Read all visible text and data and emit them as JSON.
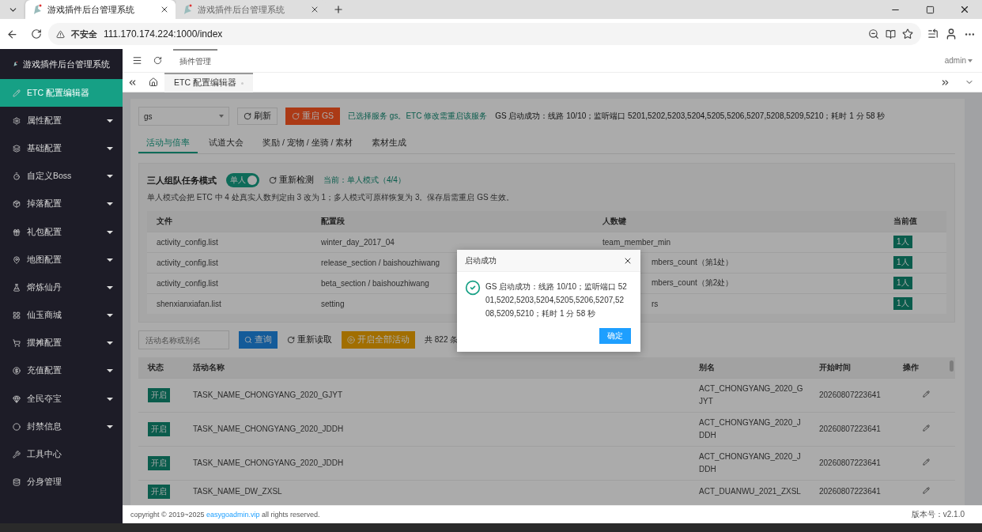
{
  "browser": {
    "tabs": [
      {
        "title": "游戏插件后台管理系统",
        "selected": true
      },
      {
        "title": "游戏插件后台管理系统",
        "selected": false
      }
    ],
    "security": "不安全",
    "url": "111.170.174.224:1000/index"
  },
  "sidebar": {
    "title": "游戏插件后台管理系统",
    "items": [
      {
        "label": "ETC 配置编辑器",
        "selected": true,
        "expandable": false
      },
      {
        "label": "属性配置",
        "selected": false,
        "expandable": true
      },
      {
        "label": "基础配置",
        "selected": false,
        "expandable": true
      },
      {
        "label": "自定义Boss",
        "selected": false,
        "expandable": true
      },
      {
        "label": "掉落配置",
        "selected": false,
        "expandable": true
      },
      {
        "label": "礼包配置",
        "selected": false,
        "expandable": true
      },
      {
        "label": "地图配置",
        "selected": false,
        "expandable": true
      },
      {
        "label": "熔炼仙丹",
        "selected": false,
        "expandable": true
      },
      {
        "label": "仙玉商城",
        "selected": false,
        "expandable": true
      },
      {
        "label": "摆摊配置",
        "selected": false,
        "expandable": true
      },
      {
        "label": "充值配置",
        "selected": false,
        "expandable": true
      },
      {
        "label": "全民夺宝",
        "selected": false,
        "expandable": true
      },
      {
        "label": "封禁信息",
        "selected": false,
        "expandable": true
      },
      {
        "label": "工具中心",
        "selected": false,
        "expandable": false
      },
      {
        "label": "分身管理",
        "selected": false,
        "expandable": false
      }
    ]
  },
  "header": {
    "tab": "插件管理",
    "user": "admin"
  },
  "page_tabs": [
    {
      "label": "ETC 配置编辑器",
      "selected": true
    }
  ],
  "toolbar": {
    "service": "gs",
    "refresh": "刷新",
    "restart": "重启 GS",
    "note": "已选择服务 gs。ETC 修改需重启该服务",
    "status": "GS 启动成功：线路 10/10；监听端口 5201,5202,5203,5204,5205,5206,5207,5208,5209,5210；耗时 1 分 58 秒"
  },
  "tabs": [
    {
      "label": "活动与倍率",
      "selected": true
    },
    {
      "label": "试道大会",
      "selected": false
    },
    {
      "label": "奖励 / 宠物 / 坐骑 / 素材",
      "selected": false
    },
    {
      "label": "素材生成",
      "selected": false
    }
  ],
  "team_mode": {
    "title": "三人组队任务模式",
    "switch": {
      "label": "单人",
      "on": true
    },
    "recheck": "重新检测",
    "current": "当前：单人模式（4/4）",
    "description": "单人模式会把 ETC 中 4 处真实人数判定由 3 改为 1；多人模式可原样恢复为 3。保存后需重启 GS 生效。",
    "columns": [
      "文件",
      "配置段",
      "人数键",
      "当前值"
    ],
    "rows": [
      {
        "file": "activity_config.list",
        "section": "winter_day_2017_04",
        "key": "team_member_min",
        "behind_dialog": false,
        "value": "1人"
      },
      {
        "file": "activity_config.list",
        "section": "release_section / baishouzhiwang",
        "key": "mbers_count（第1处）",
        "behind_dialog": true,
        "value": "1人"
      },
      {
        "file": "activity_config.list",
        "section": "beta_section / baishouzhiwang",
        "key": "mbers_count（第2处）",
        "behind_dialog": true,
        "value": "1人"
      },
      {
        "file": "shenxianxiafan.list",
        "section": "setting",
        "key": "rs",
        "behind_dialog": true,
        "value": "1人"
      }
    ]
  },
  "search": {
    "placeholder": "活动名称或别名",
    "query": "查询",
    "reload": "重新读取",
    "enable_all": "开启全部活动",
    "count": "共 822 条"
  },
  "activities": {
    "columns": [
      "状态",
      "活动名称",
      "别名",
      "开始时间",
      "操作"
    ],
    "rows": [
      {
        "status": "开启",
        "name": "TASK_NAME_CHONGYANG_2020_GJYT",
        "alias": "ACT_CHONGYANG_2020_GJYT",
        "start": "20260807223641"
      },
      {
        "status": "开启",
        "name": "TASK_NAME_CHONGYANG_2020_JDDH",
        "alias": "ACT_CHONGYANG_2020_JDDH",
        "start": "20260807223641"
      },
      {
        "status": "开启",
        "name": "TASK_NAME_CHONGYANG_2020_JDDH",
        "alias": "ACT_CHONGYANG_2020_JDDH",
        "start": "20260807223641"
      },
      {
        "status": "开启",
        "name": "TASK_NAME_DW_ZXSL",
        "alias": "ACT_DUANWU_2021_ZXSL",
        "start": "20260807223641"
      }
    ]
  },
  "dialog": {
    "title": "启动成功",
    "message": "GS 启动成功：线路 10/10；监听端口 5201,5202,5203,5204,5205,5206,5207,5208,5209,5210；耗时 1 分 58 秒",
    "ok": "确定"
  },
  "footer": {
    "copyright": "copyright © 2019~2025",
    "link": "easygoadmin.vip",
    "rights": "all rights reserved.",
    "version": "版本号：v2.1.0"
  }
}
